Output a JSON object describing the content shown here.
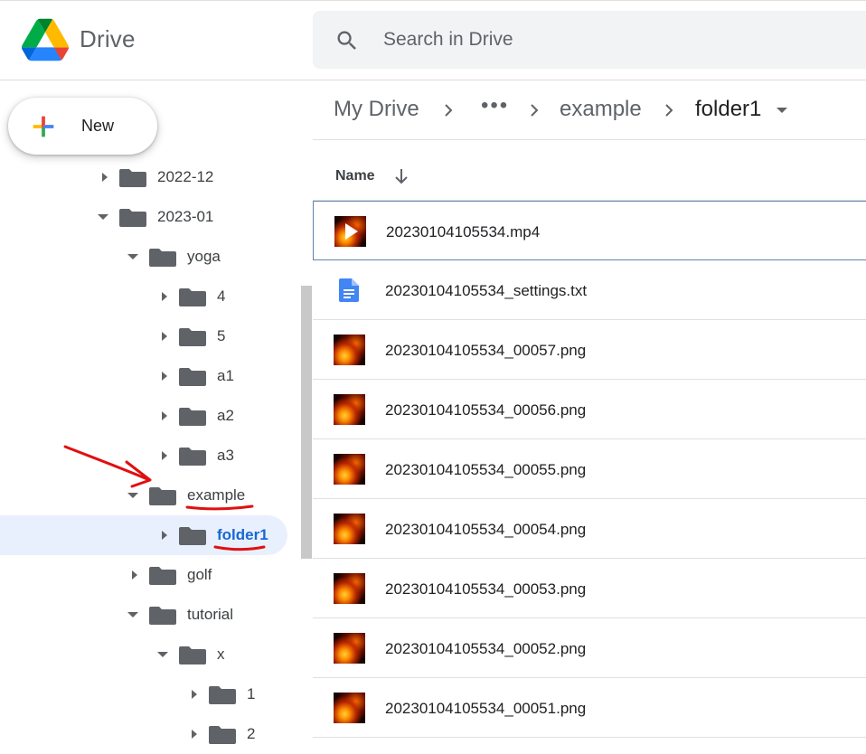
{
  "app": {
    "name": "Drive"
  },
  "search": {
    "placeholder": "Search in Drive"
  },
  "new_button": {
    "label": "New"
  },
  "sidebar": {
    "tree": [
      {
        "label": "2022-12",
        "expanded": false
      },
      {
        "label": "2023-01",
        "expanded": true
      },
      {
        "label": "yoga",
        "expanded": true
      },
      {
        "label": "4",
        "expanded": false
      },
      {
        "label": "5",
        "expanded": false
      },
      {
        "label": "a1",
        "expanded": false
      },
      {
        "label": "a2",
        "expanded": false
      },
      {
        "label": "a3",
        "expanded": false
      },
      {
        "label": "example",
        "expanded": true
      },
      {
        "label": "folder1",
        "expanded": false,
        "selected": true
      },
      {
        "label": "golf",
        "expanded": false
      },
      {
        "label": "tutorial",
        "expanded": true
      },
      {
        "label": "x",
        "expanded": true
      },
      {
        "label": "1",
        "expanded": false
      },
      {
        "label": "2",
        "expanded": false
      }
    ]
  },
  "breadcrumb": {
    "root": "My Drive",
    "ellipsis": "•••",
    "parent": "example",
    "current": "folder1"
  },
  "file_list": {
    "header": {
      "name": "Name",
      "sort": "arrow-down-icon"
    },
    "files": [
      {
        "name": "20230104105534.mp4",
        "type": "video"
      },
      {
        "name": "20230104105534_settings.txt",
        "type": "doc"
      },
      {
        "name": "20230104105534_00057.png",
        "type": "image"
      },
      {
        "name": "20230104105534_00056.png",
        "type": "image"
      },
      {
        "name": "20230104105534_00055.png",
        "type": "image"
      },
      {
        "name": "20230104105534_00054.png",
        "type": "image"
      },
      {
        "name": "20230104105534_00053.png",
        "type": "image"
      },
      {
        "name": "20230104105534_00052.png",
        "type": "image"
      },
      {
        "name": "20230104105534_00051.png",
        "type": "image"
      }
    ]
  },
  "colors": {
    "accent": "#1967d2",
    "selected_bg": "#e8f0fe",
    "annotation": "#e01010",
    "folder": "#5f6368",
    "doc_icon": "#4285f4"
  }
}
